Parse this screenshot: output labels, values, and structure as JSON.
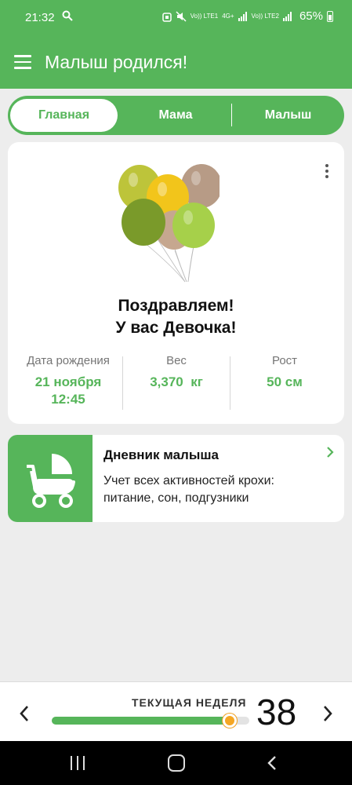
{
  "status": {
    "time": "21:32",
    "lte1": "Vo)) LTE1",
    "sig": "4G+",
    "lte2": "Vo)) LTE2",
    "battery": "65%"
  },
  "appbar": {
    "title": "Малыш родился!"
  },
  "tabs": [
    {
      "label": "Главная",
      "active": true
    },
    {
      "label": "Мама",
      "active": false
    },
    {
      "label": "Малыш",
      "active": false
    }
  ],
  "card": {
    "line1": "Поздравляем!",
    "line2": "У вас Девочка!",
    "stats": [
      {
        "label": "Дата рождения",
        "value": "21 ноября",
        "value2": "12:45"
      },
      {
        "label": "Вес",
        "value": "3,370  кг"
      },
      {
        "label": "Рост",
        "value": "50 см"
      }
    ]
  },
  "diary": {
    "title": "Дневник малыша",
    "description": "Учет всех активностей крохи: питание, сон, подгузники"
  },
  "week": {
    "label": "ТЕКУЩАЯ НЕДЕЛЯ",
    "number": "38",
    "progress": 0.9
  },
  "colors": {
    "accent": "#56b55a",
    "knob": "#f5a623"
  },
  "icons": [
    "menu-icon",
    "more-vert-icon",
    "stroller-icon",
    "chevron-right-icon",
    "chevron-left-icon"
  ]
}
